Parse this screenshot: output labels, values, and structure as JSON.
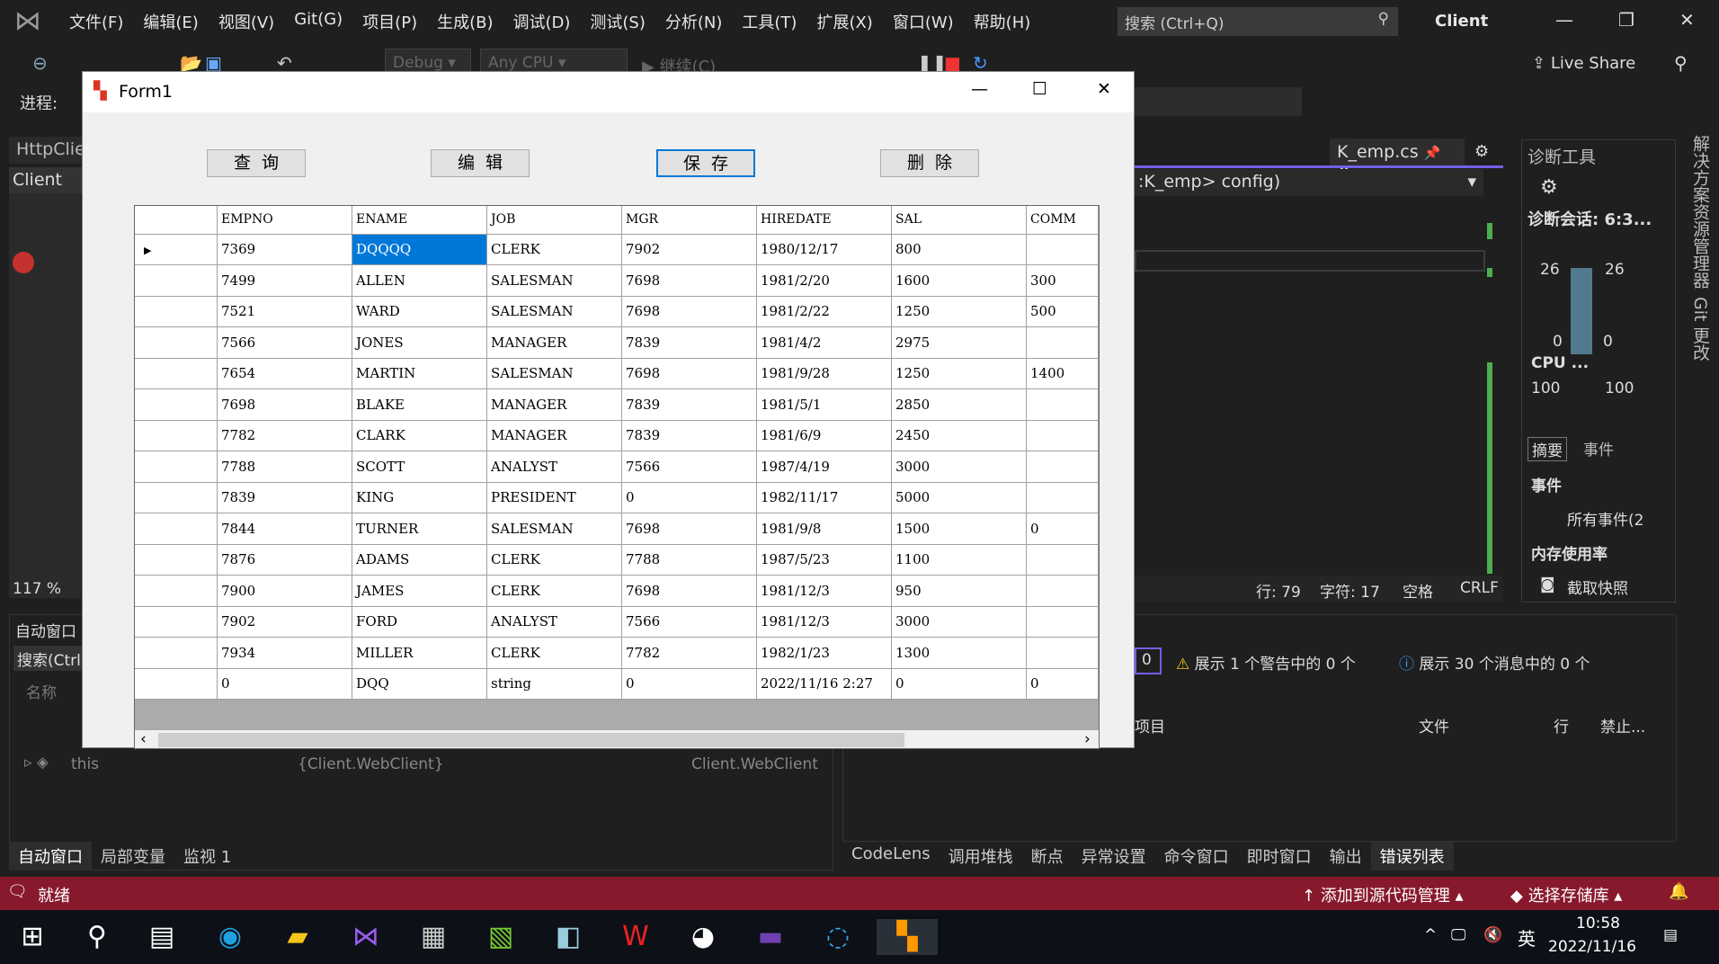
{
  "ide": {
    "menu": [
      "文件(F)",
      "编辑(E)",
      "视图(V)",
      "Git(G)",
      "项目(P)",
      "生成(B)",
      "调试(D)",
      "测试(S)",
      "分析(N)",
      "工具(T)",
      "扩展(X)",
      "窗口(W)",
      "帮助(H)"
    ],
    "search_placeholder": "搜索 (Ctrl+Q)",
    "app_title": "Client",
    "config": "Debug",
    "platform": "Any CPU",
    "continue": "继续(C)",
    "live_share": "Live Share",
    "process_label": "进程:",
    "left_tabs": [
      "HttpClie",
      "Client"
    ],
    "doc_tab": "K_emp.cs",
    "nav": ":K_emp> config)",
    "status_line": {
      "line": "行: 79",
      "char": "字符: 17",
      "spaces": "空格",
      "eol": "CRLF"
    },
    "zoom": "117 %",
    "diag": {
      "title": "诊断工具",
      "session": "诊断会话: 6:3...",
      "mem_top_l": "26",
      "mem_top_r": "26",
      "mem_bot_l": "0",
      "mem_bot_r": "0",
      "cpu": "CPU ...",
      "cpu_l": "100",
      "cpu_r": "100",
      "tabs": [
        "摘要",
        "事件"
      ],
      "events_h": "事件",
      "all_events": "所有事件(2",
      "mem_h": "内存使用率",
      "snapshot": "截取快照"
    },
    "side_tabs": [
      "解决方案资源管理器",
      "Git 更改"
    ],
    "auto": {
      "title": "自动窗口",
      "search": "搜索(Ctrl",
      "col_name": "名称",
      "rows": [
        {
          "name": "this",
          "value": "{Client.WebClient}",
          "type": "Client.WebClient"
        }
      ]
    },
    "errors": {
      "count": "0",
      "warn": "展示 1 个警告中的 0 个",
      "msg": "展示 30 个消息中的 0 个",
      "cols": [
        "项目",
        "文件",
        "行",
        "禁止..."
      ]
    },
    "bottom_left_tabs": [
      "自动窗口",
      "局部变量",
      "监视 1"
    ],
    "bottom_right_tabs": [
      "CodeLens",
      "调用堆栈",
      "断点",
      "异常设置",
      "命令窗口",
      "即时窗口",
      "输出",
      "错误列表"
    ],
    "statusbar": {
      "ready": "就绪",
      "source": "添加到源代码管理",
      "repo": "选择存储库"
    },
    "clock": {
      "time": "10:58",
      "date": "2022/11/16"
    },
    "ime": "英"
  },
  "form": {
    "title": "Form1",
    "buttons": {
      "query": "查询",
      "edit": "编辑",
      "save": "保存",
      "delete": "删除"
    },
    "columns": [
      "EMPNO",
      "ENAME",
      "JOB",
      "MGR",
      "HIREDATE",
      "SAL",
      "COMM"
    ],
    "rows": [
      [
        "7369",
        "DQQQQ",
        "CLERK",
        "7902",
        "1980/12/17",
        "800",
        ""
      ],
      [
        "7499",
        "ALLEN",
        "SALESMAN",
        "7698",
        "1981/2/20",
        "1600",
        "300"
      ],
      [
        "7521",
        "WARD",
        "SALESMAN",
        "7698",
        "1981/2/22",
        "1250",
        "500"
      ],
      [
        "7566",
        "JONES",
        "MANAGER",
        "7839",
        "1981/4/2",
        "2975",
        ""
      ],
      [
        "7654",
        "MARTIN",
        "SALESMAN",
        "7698",
        "1981/9/28",
        "1250",
        "1400"
      ],
      [
        "7698",
        "BLAKE",
        "MANAGER",
        "7839",
        "1981/5/1",
        "2850",
        ""
      ],
      [
        "7782",
        "CLARK",
        "MANAGER",
        "7839",
        "1981/6/9",
        "2450",
        ""
      ],
      [
        "7788",
        "SCOTT",
        "ANALYST",
        "7566",
        "1987/4/19",
        "3000",
        ""
      ],
      [
        "7839",
        "KING",
        "PRESIDENT",
        "0",
        "1982/11/17",
        "5000",
        ""
      ],
      [
        "7844",
        "TURNER",
        "SALESMAN",
        "7698",
        "1981/9/8",
        "1500",
        "0"
      ],
      [
        "7876",
        "ADAMS",
        "CLERK",
        "7788",
        "1987/5/23",
        "1100",
        ""
      ],
      [
        "7900",
        "JAMES",
        "CLERK",
        "7698",
        "1981/12/3",
        "950",
        ""
      ],
      [
        "7902",
        "FORD",
        "ANALYST",
        "7566",
        "1981/12/3",
        "3000",
        ""
      ],
      [
        "7934",
        "MILLER",
        "CLERK",
        "7782",
        "1982/1/23",
        "1300",
        ""
      ],
      [
        "0",
        "DQQ",
        "string",
        "0",
        "2022/11/16 2:27",
        "0",
        "0"
      ]
    ]
  }
}
